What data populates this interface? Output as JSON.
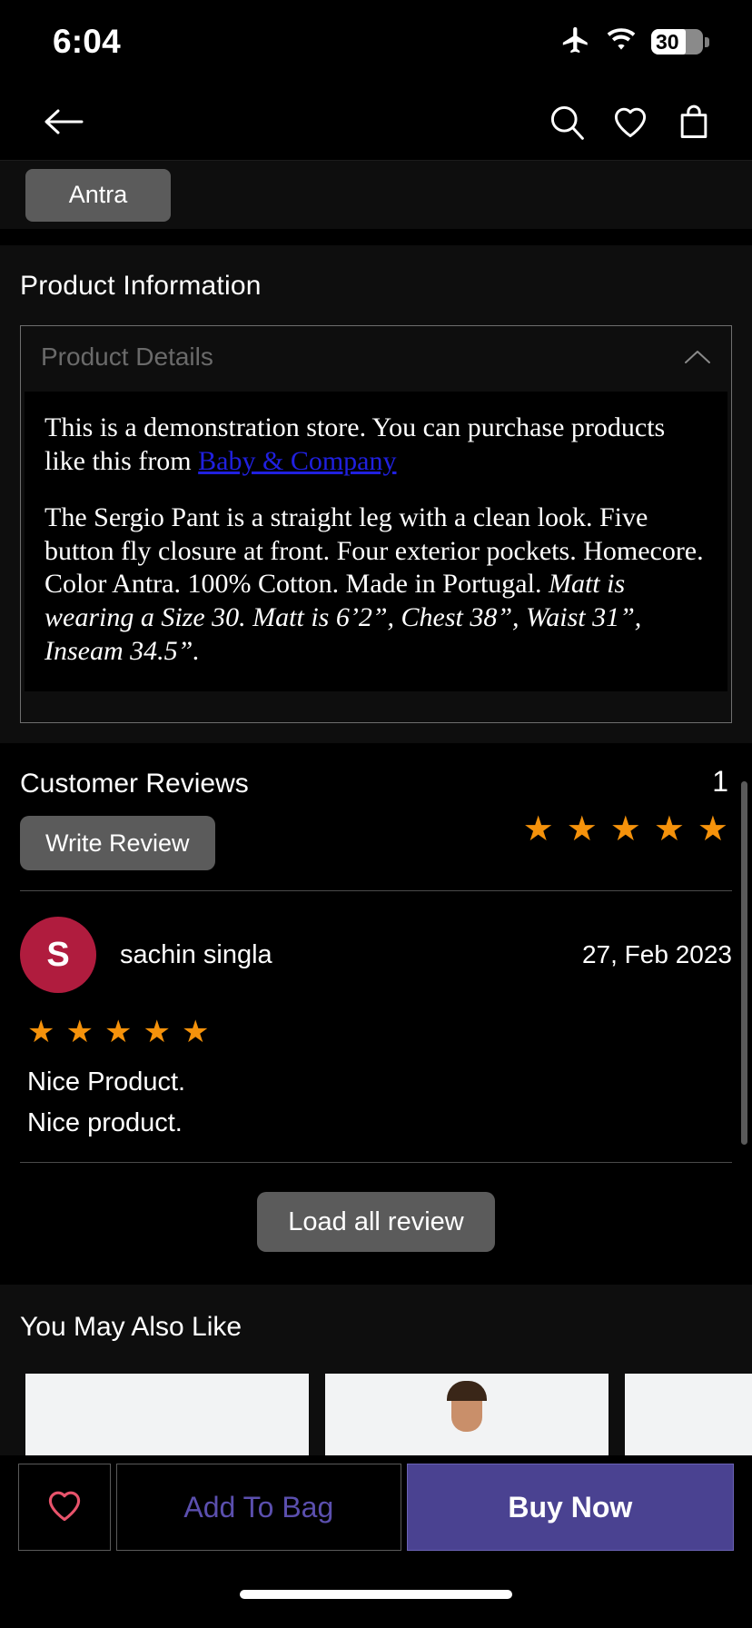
{
  "status_bar": {
    "time": "6:04",
    "airplane_icon": "airplane-icon",
    "wifi_icon": "wifi-icon",
    "battery_level": "30"
  },
  "nav_bar": {
    "back_icon": "back-arrow-icon",
    "search_icon": "search-icon",
    "wishlist_icon": "heart-icon",
    "bag_icon": "shopping-bag-icon"
  },
  "color_swatch": {
    "selected_label": "Antra"
  },
  "product_information": {
    "section_title": "Product Information",
    "accordion": {
      "label": "Product Details",
      "chevron_icon": "chevron-up-icon",
      "expanded": true,
      "paragraph_1_before_link": "This is a demonstration store. You can purchase products like this from ",
      "link_text": "Baby & Company",
      "paragraph_2_plain": "The Sergio Pant is a straight leg with a clean look. Five button fly closure at front. Four exterior pockets. Homecore. Color Antra. 100% Cotton. Made in Portugal. ",
      "paragraph_2_italic": "Matt is wearing a Size 30. Matt is 6’2”, Chest 38”, Waist 31”, Inseam 34.5”."
    }
  },
  "customer_reviews": {
    "section_title": "Customer Reviews",
    "write_review_label": "Write Review",
    "review_count": "1",
    "summary_rating": 5,
    "star_color": "#f5920b",
    "reviews": [
      {
        "avatar_initial": "S",
        "avatar_color": "#b01c3e",
        "author": "sachin singla",
        "date": "27, Feb 2023",
        "rating": 5,
        "title": "Nice Product.",
        "body": "Nice product."
      }
    ],
    "load_all_label": "Load all review"
  },
  "you_may_also_like": {
    "section_title": "You May Also Like",
    "items": [
      {
        "name": "product-card-1"
      },
      {
        "name": "product-card-2"
      },
      {
        "name": "product-card-3"
      }
    ]
  },
  "action_bar": {
    "wishlist_icon": "heart-outline-icon",
    "wishlist_color": "#e8536b",
    "add_to_bag_label": "Add To Bag",
    "add_to_bag_color": "#5b4fae",
    "buy_now_label": "Buy Now",
    "buy_now_bg": "#4a4291"
  }
}
